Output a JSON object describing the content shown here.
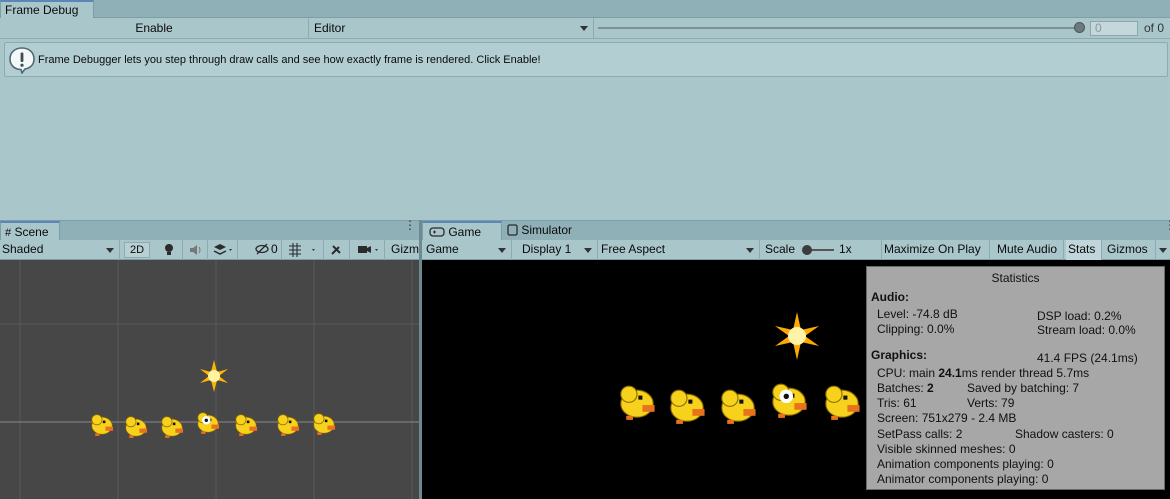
{
  "frame_debug": {
    "tab_label": "Frame Debug",
    "enable_label": "Enable",
    "target_value": "Editor",
    "event_index": "0",
    "event_total": "of 0",
    "info_text": "Frame Debugger lets you step through draw calls and see how exactly frame is rendered. Click Enable!"
  },
  "scene": {
    "tab_label": "Scene",
    "draw_mode": "Shaded",
    "mode_2d": "2D",
    "hidden_count": "0",
    "gizmos_label": "Gizm"
  },
  "game": {
    "tab_label": "Game",
    "simulator_tab_label": "Simulator",
    "view_mode": "Game",
    "display": "Display 1",
    "aspect": "Free Aspect",
    "scale_label": "Scale",
    "scale_value": "1x",
    "maximize_on_play": "Maximize On Play",
    "mute_audio": "Mute Audio",
    "stats": "Stats",
    "gizmos": "Gizmos"
  },
  "statistics": {
    "title": "Statistics",
    "audio_heading": "Audio:",
    "level": "Level: -74.8 dB",
    "dsp_load": "DSP load: 0.2%",
    "clipping": "Clipping: 0.0%",
    "stream_load": "Stream load: 0.0%",
    "graphics_heading": "Graphics:",
    "fps": "41.4 FPS (24.1ms)",
    "cpu_prefix": "CPU: main ",
    "cpu_main": "24.1",
    "cpu_suffix": "ms  render thread 5.7ms",
    "batches_prefix": "Batches: ",
    "batches": "2",
    "saved_by_batching": "Saved by batching: 7",
    "tris": "Tris: 61",
    "verts": "Verts: 79",
    "screen": "Screen: 751x279 - 2.4 MB",
    "setpass": "SetPass calls: 2",
    "shadow_casters": "Shadow casters: 0",
    "skinned_meshes": "Visible skinned meshes: 0",
    "animation_components": "Animation components playing: 0",
    "animator_components": "Animator components playing: 0"
  },
  "colors": {
    "editor_bg": "#a9c6cb",
    "tab_accent": "#5a86b8",
    "scene_bg": "#474747",
    "game_bg": "#000000",
    "duck_yellow": "#f7d21d",
    "duck_beak": "#e8731c"
  }
}
